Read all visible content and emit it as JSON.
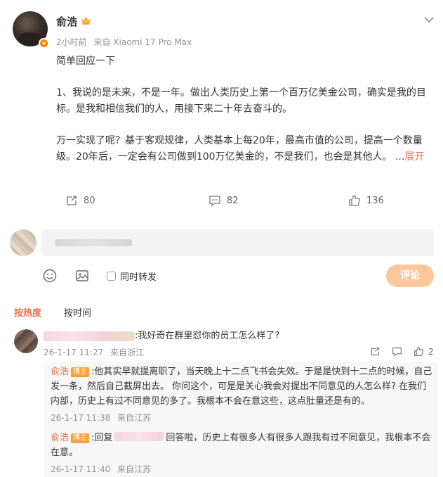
{
  "post": {
    "author": "俞浩",
    "time": "2小时前",
    "source": "来自 Xiaomi 17 Pro Max",
    "paragraphs": [
      "简单回应一下",
      "1、我说的是未来，不是一年。做出人类历史上第一个百万亿美金公司，确实是我的目标。是我和相信我们的人，用接下来二十年去奋斗的。",
      "万一实现了呢？基于客观规律，人类基本上每20年，最高市值的公司，提高一个数量级。20年后，一定会有公司做到100万亿美金的，不是我们，也会是其他人。 ..."
    ],
    "expand_label": "展开",
    "icons": {
      "more": "chevron-down-icon",
      "vip": "crown-icon",
      "verified": "verified-badge-icon"
    }
  },
  "actions": {
    "repost_count": "80",
    "comment_count": "82",
    "like_count": "136",
    "icons": [
      "repost-icon",
      "comment-icon",
      "like-icon"
    ]
  },
  "composer": {
    "emoji_icon": "emoji-icon",
    "image_icon": "image-icon",
    "repost_checkbox_label": "同时转发",
    "submit_label": "评论"
  },
  "sort_tabs": {
    "hot": "按热度",
    "time": "按时间"
  },
  "comments": [
    {
      "text": ":我好奇在群里怼你的员工怎么样了?",
      "date": "26-1-17 11:27",
      "location": "来自浙江",
      "like_count": "2",
      "replies": [
        {
          "author": "俞浩",
          "tag": "博主",
          "text": ":他其实早就提离职了，当天晚上十二点飞书会失效。于是是快到十二点的时候，自己发一条，然后自己截屏出去。  你问这个，可是是关心我会对提出不同意见的人怎么样? 在我们内部，历史上有过不同意见的多了。我根本不会在意这些，这点肚量还是有的。",
          "date": "26-1-17 11:38",
          "location": "来自江苏"
        },
        {
          "author": "俞浩",
          "tag": "博主",
          "prefix": ":回复",
          "text": "回答啦，历史上有很多人有很多人跟我有过不同意见，我根本不会在意。",
          "date": "26-1-17 11:40",
          "location": "来自江苏"
        }
      ]
    }
  ],
  "colors": {
    "accent": "#eb7350",
    "submit_disabled": "#fcc79a",
    "meta_gray": "#939393",
    "tag_orange": "#f9a13a"
  }
}
